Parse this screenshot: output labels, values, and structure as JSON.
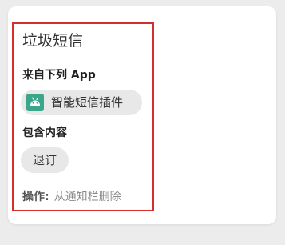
{
  "rule": {
    "title": "垃圾短信",
    "from_label": "来自下列 App",
    "app": {
      "name": "智能短信插件",
      "icon": "android-robot-icon",
      "icon_color": "#3aa68a"
    },
    "contains_label": "包含内容",
    "keyword": "退订",
    "action_label": "操作:",
    "action_value": "从通知栏删除"
  },
  "colors": {
    "highlight_border": "#d32f2f",
    "card_background": "#ffffff",
    "chip_background": "#e8e8e8"
  }
}
